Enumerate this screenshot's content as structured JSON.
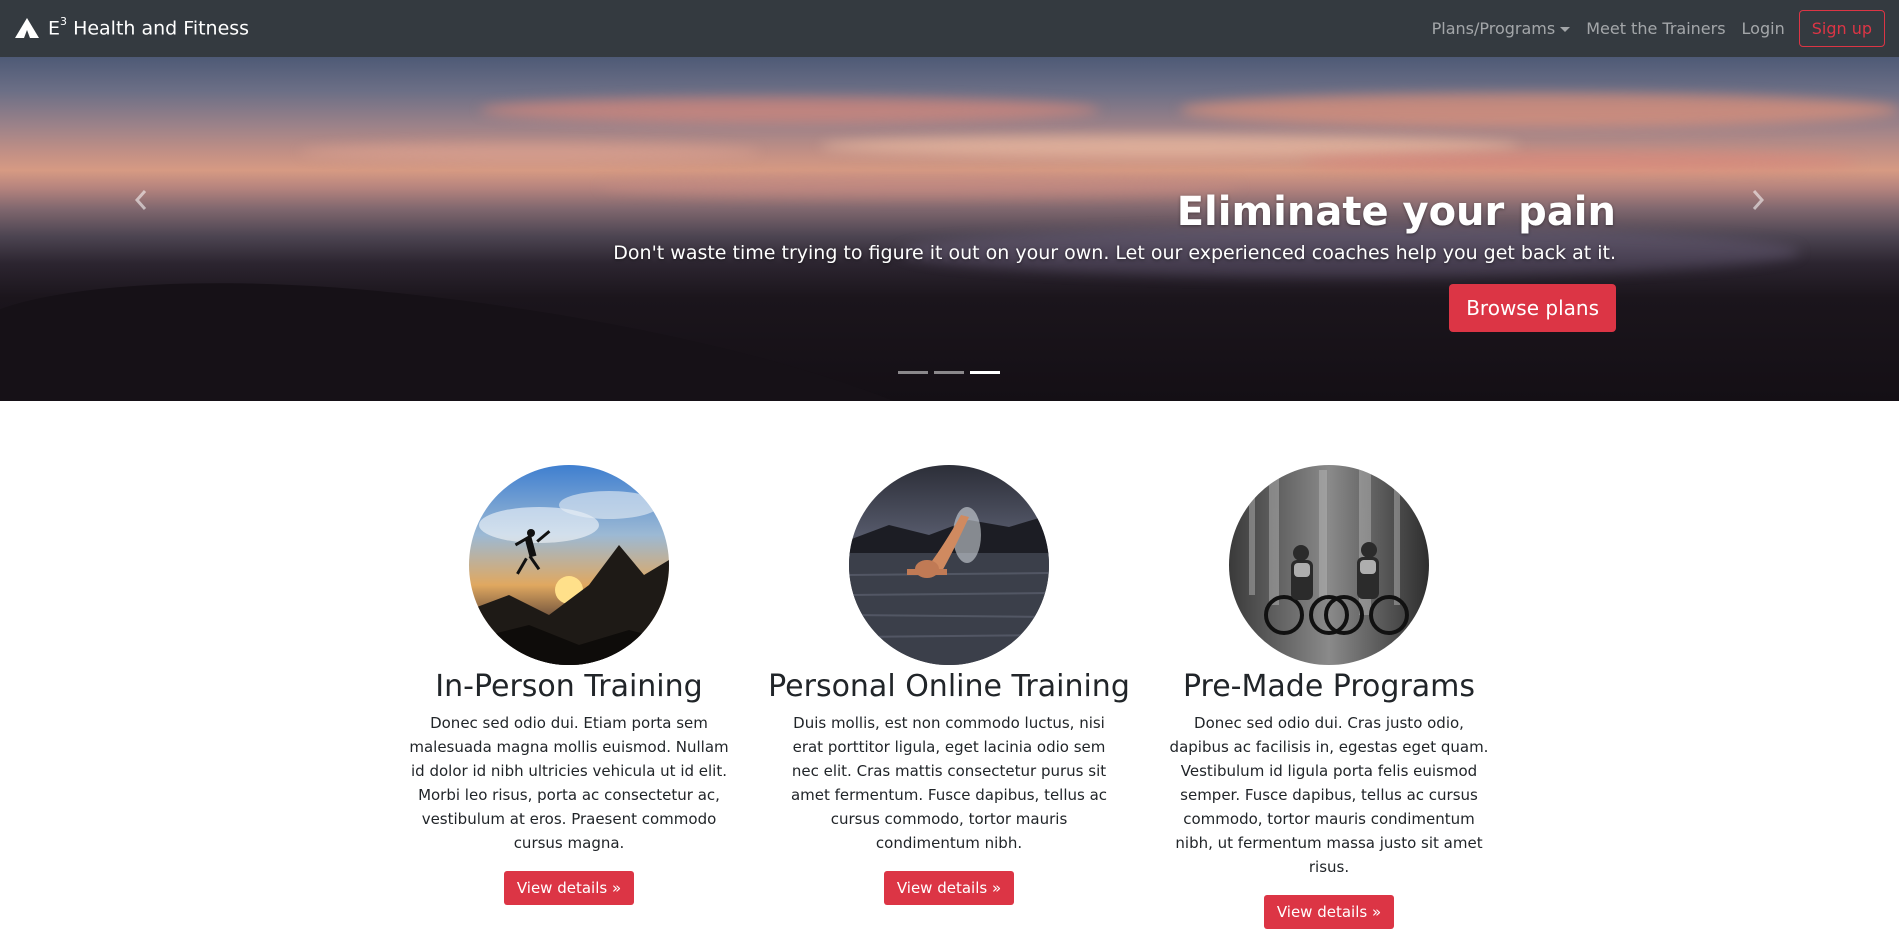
{
  "navbar": {
    "brand_prefix": "E",
    "brand_sup": "3",
    "brand_name": "Health and Fitness",
    "links": {
      "plans": "Plans/Programs",
      "trainers": "Meet the Trainers",
      "login": "Login",
      "signup": "Sign up"
    }
  },
  "carousel": {
    "heading": "Eliminate your pain",
    "text": "Don't waste time trying to figure it out on your own. Let our experienced coaches help you get back at it.",
    "button": "Browse plans",
    "slide_count": 3,
    "active_slide": 3
  },
  "features": [
    {
      "title": "In-Person Training",
      "text": "Donec sed odio dui. Etiam porta sem malesuada magna mollis euismod. Nullam id dolor id nibh ultricies vehicula ut id elit. Morbi leo risus, porta ac consectetur ac, vestibulum at eros. Praesent commodo cursus magna.",
      "button": "View details »"
    },
    {
      "title": "Personal Online Training",
      "text": "Duis mollis, est non commodo luctus, nisi erat porttitor ligula, eget lacinia odio sem nec elit. Cras mattis consectetur purus sit amet fermentum. Fusce dapibus, tellus ac cursus commodo, tortor mauris condimentum nibh.",
      "button": "View details »"
    },
    {
      "title": "Pre-Made Programs",
      "text": "Donec sed odio dui. Cras justo odio, dapibus ac facilisis in, egestas eget quam. Vestibulum id ligula porta felis euismod semper. Fusce dapibus, tellus ac cursus commodo, tortor mauris condimentum nibh, ut fermentum massa justo sit amet risus.",
      "button": "View details »"
    }
  ],
  "colors": {
    "navbar_bg": "#343a40",
    "accent": "#dc3545"
  },
  "icons": {
    "logo": "mountain-icon",
    "prev": "chevron-left-icon",
    "next": "chevron-right-icon"
  }
}
